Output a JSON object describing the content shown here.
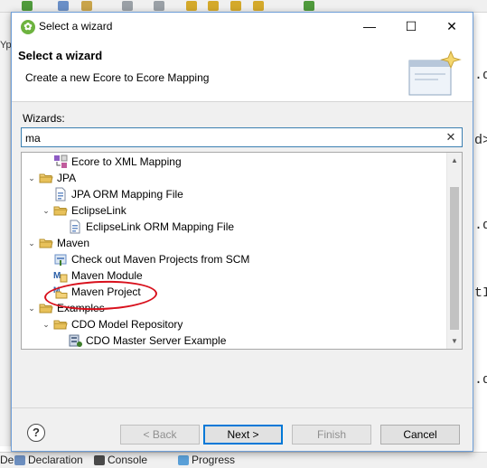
{
  "ide": {
    "left_tab_text": "Ypo",
    "bottom_left_text": "De",
    "bottom_tabs": [
      {
        "label": "Declaration",
        "icon": "declaration-icon"
      },
      {
        "label": "Console",
        "icon": "console-icon"
      },
      {
        "label": "Progress",
        "icon": "progress-icon"
      }
    ],
    "editor_fragments": [
      {
        "text": ".d"
      },
      {
        "text": "d>"
      },
      {
        "text": ".d"
      },
      {
        "text": "tI"
      },
      {
        "text": ".d"
      }
    ]
  },
  "dialog": {
    "title": "Select a wizard",
    "title_icon": "spring-leaf-icon",
    "window_buttons": {
      "minimize": "—",
      "maximize": "☐",
      "close": "✕"
    },
    "header": {
      "title": "Select a wizard",
      "description": "Create a new Ecore to Ecore Mapping",
      "banner_icon": "wizard-banner-icon"
    },
    "wizards_label": "Wizards:",
    "filter": {
      "value": "ma",
      "clear_icon": "clear-icon"
    },
    "tree": [
      {
        "label": "Ecore to XML Mapping",
        "level": 1,
        "kind": "item",
        "icon": "ecore-mapping-icon"
      },
      {
        "label": "JPA",
        "level": 0,
        "kind": "folder",
        "expanded": true,
        "icon": "folder-icon"
      },
      {
        "label": "JPA ORM Mapping File",
        "level": 1,
        "kind": "item",
        "icon": "orm-file-icon"
      },
      {
        "label": "EclipseLink",
        "level": 1,
        "kind": "folder",
        "expanded": true,
        "icon": "folder-icon"
      },
      {
        "label": "EclipseLink ORM Mapping File",
        "level": 2,
        "kind": "item",
        "icon": "orm-file-icon"
      },
      {
        "label": "Maven",
        "level": 0,
        "kind": "folder",
        "expanded": true,
        "icon": "folder-icon"
      },
      {
        "label": "Check out Maven Projects from SCM",
        "level": 1,
        "kind": "item",
        "icon": "scm-checkout-icon"
      },
      {
        "label": "Maven Module",
        "level": 1,
        "kind": "item",
        "icon": "maven-module-icon"
      },
      {
        "label": "Maven Project",
        "level": 1,
        "kind": "item",
        "icon": "maven-project-icon",
        "annotated": true
      },
      {
        "label": "Examples",
        "level": 0,
        "kind": "folder",
        "expanded": true,
        "icon": "folder-icon"
      },
      {
        "label": "CDO Model Repository",
        "level": 1,
        "kind": "folder",
        "expanded": true,
        "icon": "folder-icon"
      },
      {
        "label": "CDO Master Server Example",
        "level": 2,
        "kind": "item",
        "icon": "cdo-server-icon"
      }
    ],
    "buttons": {
      "help": "?",
      "back": "< Back",
      "next": "Next >",
      "finish": "Finish",
      "cancel": "Cancel"
    },
    "colors": {
      "accent": "#0078d7",
      "annotation": "#d8101c",
      "folder": "#e8c15a"
    }
  }
}
